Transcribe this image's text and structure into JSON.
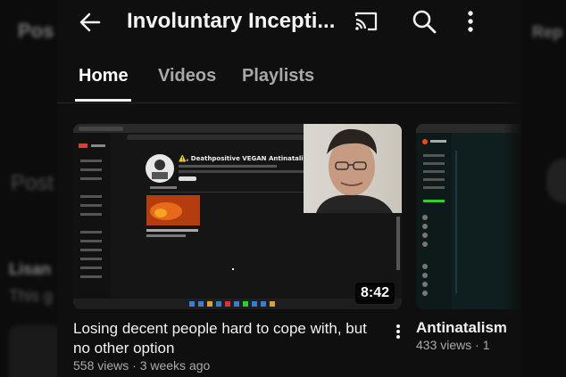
{
  "background": {
    "heading_left": "Pos",
    "heading_right": "Rep",
    "section": "Post",
    "user": "Lisan",
    "text": "This g"
  },
  "topbar": {
    "title": "Involuntary Incepti...",
    "back_icon": "arrow-left-icon",
    "cast_icon": "cast-icon",
    "search_icon": "search-icon",
    "more_icon": "more-vert-icon"
  },
  "tabs": [
    {
      "label": "Home",
      "active": true
    },
    {
      "label": "Videos",
      "active": false
    },
    {
      "label": "Playlists",
      "active": false
    }
  ],
  "videos": [
    {
      "duration": "8:42",
      "title": "Losing decent people hard to cope with, but no other option",
      "views": "558 views",
      "age": "3 weeks ago",
      "meta": "558 views · 3 weeks ago",
      "thumbnail": {
        "channel_name": "⚠️, Deathpositive VEGAN Antinatalist ⚠️"
      }
    },
    {
      "title": "Antinatalism",
      "meta": "433 views · 1"
    }
  ],
  "colors": {
    "background": "#0f0f0f",
    "text": "#f1f1f1",
    "secondary_text": "#aaaaaa"
  }
}
